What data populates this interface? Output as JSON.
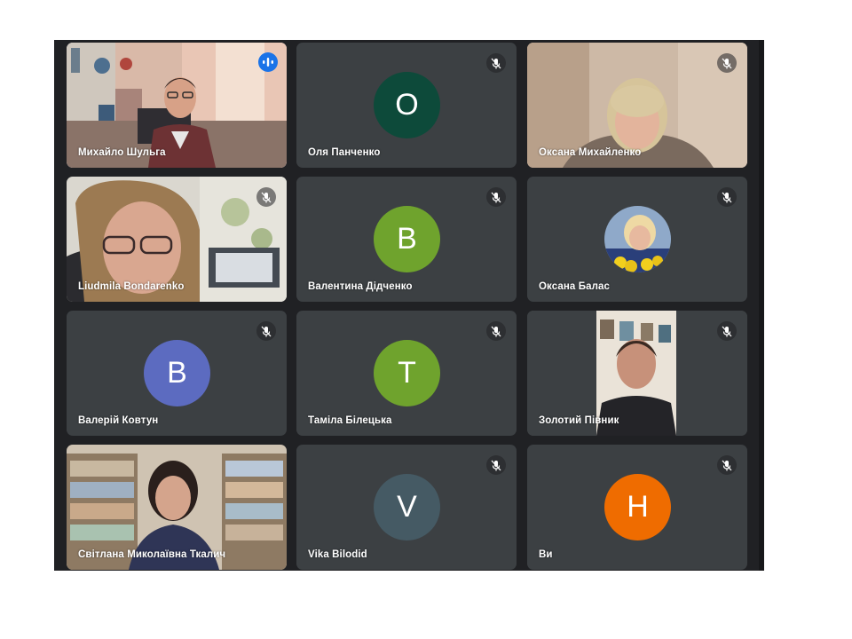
{
  "participants": [
    {
      "name": "Михайло Шульга",
      "type": "video",
      "speaking": true
    },
    {
      "name": "Оля Панченко",
      "type": "letter",
      "initial": "О",
      "color": "#0d4a3a",
      "muted": true
    },
    {
      "name": "Оксана Михайленко",
      "type": "video",
      "muted": true
    },
    {
      "name": "Liudmila Bondarenko",
      "type": "video",
      "muted": true
    },
    {
      "name": "Валентина Дідченко",
      "type": "letter",
      "initial": "В",
      "color": "#6fa32d",
      "muted": true
    },
    {
      "name": "Оксана Балас",
      "type": "photo-avatar",
      "muted": true
    },
    {
      "name": "Валерій Ковтун",
      "type": "letter",
      "initial": "В",
      "color": "#5c6bc0",
      "muted": true
    },
    {
      "name": "Таміла Білецька",
      "type": "letter",
      "initial": "Т",
      "color": "#6fa32d",
      "muted": true
    },
    {
      "name": "Золотий Півник",
      "type": "video",
      "muted": true
    },
    {
      "name": "Світлана Миколаївна Ткалич",
      "type": "video",
      "muted": false
    },
    {
      "name": "Vika Bilodid",
      "type": "letter",
      "initial": "V",
      "color": "#455a64",
      "muted": true
    },
    {
      "name": "Ви",
      "type": "letter",
      "initial": "Н",
      "color": "#ef6c00",
      "muted": true
    }
  ],
  "icons": {
    "muted": "mic-off-icon",
    "speaking": "audio-level-icon"
  },
  "colors": {
    "background": "#202124",
    "tile": "#3c4043",
    "active_border": "#8ab4f8"
  }
}
